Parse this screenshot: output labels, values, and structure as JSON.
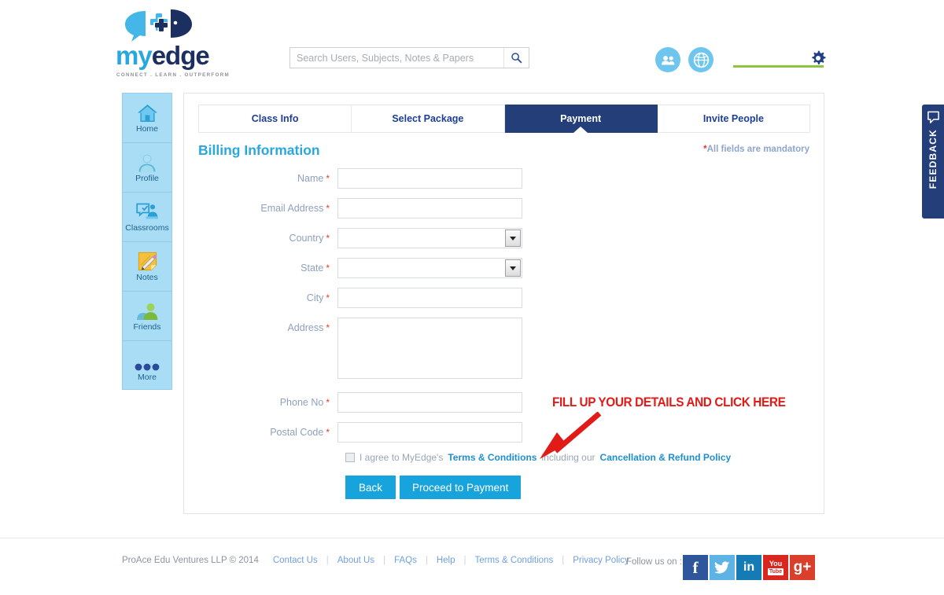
{
  "brand": {
    "logo_my": "my",
    "logo_edge": "edge",
    "tagline": "CONNECT . LEARN . OUTPERFORM",
    "accent_blue": "#29a8e0",
    "navy": "#233e79",
    "button_blue": "#17a3dc",
    "green": "#8cc63f",
    "required_red": "#e8392e"
  },
  "header": {
    "search": {
      "placeholder": "Search Users, Subjects, Notes & Papers",
      "value": ""
    },
    "icons": {
      "search": "search-icon",
      "friends": "people-icon",
      "globe": "globe-icon",
      "settings": "gear-icon"
    }
  },
  "sidebar": {
    "items": [
      {
        "label": "Home",
        "icon": "home-icon"
      },
      {
        "label": "Profile",
        "icon": "user-icon"
      },
      {
        "label": "Classrooms",
        "icon": "classroom-icon"
      },
      {
        "label": "Notes",
        "icon": "notes-icon"
      },
      {
        "label": "Friends",
        "icon": "friends-icon"
      },
      {
        "label": "More",
        "icon": "more-dots-icon"
      }
    ]
  },
  "main": {
    "tabs": [
      {
        "label": "Class Info",
        "active": false
      },
      {
        "label": "Select Package",
        "active": false
      },
      {
        "label": "Payment",
        "active": true
      },
      {
        "label": "Invite People",
        "active": false
      }
    ],
    "section_title": "Billing Information",
    "mandatory_star": "*",
    "mandatory_note": "All fields are mandatory",
    "fields": [
      {
        "label": "Name",
        "required": "*",
        "type": "text",
        "value": ""
      },
      {
        "label": "Email Address",
        "required": "*",
        "type": "text",
        "value": ""
      },
      {
        "label": "Country",
        "required": "*",
        "type": "select",
        "value": ""
      },
      {
        "label": "State",
        "required": "*",
        "type": "select",
        "value": ""
      },
      {
        "label": "City",
        "required": "*",
        "type": "text",
        "value": ""
      },
      {
        "label": "Address",
        "required": "*",
        "type": "textarea",
        "value": ""
      },
      {
        "label": "Phone No",
        "required": "*",
        "type": "text",
        "value": ""
      },
      {
        "label": "Postal Code",
        "required": "*",
        "type": "text",
        "value": ""
      }
    ],
    "agreement": {
      "checked": false,
      "text_before": "I agree to MyEdge's",
      "link_terms": "Terms & Conditions",
      "text_middle": "including our",
      "link_refund": "Cancellation & Refund Policy"
    },
    "buttons": {
      "back": "Back",
      "proceed": "Proceed to Payment"
    }
  },
  "annotation": {
    "text": "FILL UP YOUR DETAILS AND CLICK HERE",
    "color": "#e11b17",
    "arrow": "red-arrow-icon"
  },
  "feedback": {
    "label": "FEEDBACK",
    "icon": "speech-bubble-icon"
  },
  "footer": {
    "copyright": "ProAce Edu Ventures LLP © 2014",
    "links": [
      "Contact Us",
      "About Us",
      "FAQs",
      "Help",
      "Terms & Conditions",
      "Privacy Policy"
    ],
    "separator": "|",
    "follow_label": "Follow us on :",
    "socials": [
      {
        "name": "facebook",
        "glyph": "f",
        "color": "#2f559a"
      },
      {
        "name": "twitter",
        "glyph": "bird",
        "color": "#5cb3e4"
      },
      {
        "name": "linkedin",
        "glyph": "in",
        "color": "#147bb5"
      },
      {
        "name": "youtube",
        "glyph": "You Tube",
        "color": "#d9271f"
      },
      {
        "name": "googleplus",
        "glyph": "g+",
        "color": "#d93f2b"
      }
    ]
  }
}
